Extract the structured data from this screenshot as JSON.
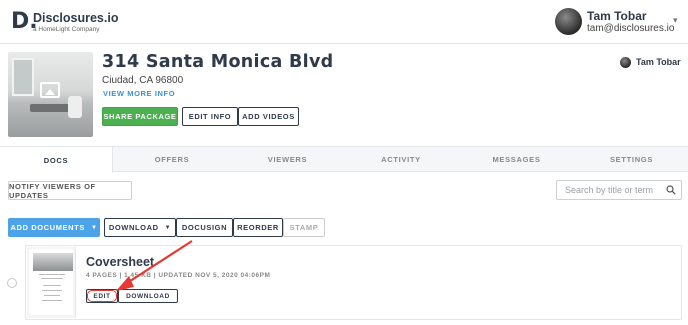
{
  "app": {
    "logo_mark": "D.",
    "name": "Disclosures.io",
    "tagline": "a HomeLight Company"
  },
  "user": {
    "name": "Tam Tobar",
    "email": "tam@disclosures.io"
  },
  "property": {
    "address": "314 Santa Monica Blvd",
    "city_line": "Ciudad, CA 96800",
    "view_more": "VIEW MORE INFO",
    "agent_name": "Tam Tobar",
    "actions": {
      "share": "SHARE PACKAGE",
      "edit_info": "EDIT INFO",
      "add_videos": "ADD VIDEOS"
    }
  },
  "tabs": [
    {
      "label": "DOCS",
      "active": true
    },
    {
      "label": "OFFERS"
    },
    {
      "label": "VIEWERS"
    },
    {
      "label": "ACTIVITY"
    },
    {
      "label": "MESSAGES"
    },
    {
      "label": "SETTINGS"
    }
  ],
  "toolbar": {
    "notify": "NOTIFY VIEWERS OF UPDATES",
    "search_placeholder": "Search by title or term",
    "add_documents": "ADD DOCUMENTS",
    "download": "DOWNLOAD",
    "docusign": "DOCUSIGN",
    "reorder": "REORDER",
    "stamp": "STAMP"
  },
  "document": {
    "title": "Coversheet",
    "meta": "4 PAGES | 1.45 KB | UPDATED NOV 5, 2020 04:06PM",
    "edit": "EDIT",
    "download": "DOWNLOAD",
    "thumb_heading": "314 Santa Monica Blvd"
  },
  "colors": {
    "primary_text": "#2f3a4a",
    "link_blue": "#3b8fd9",
    "share_green": "#4caf50",
    "add_docs_blue": "#4da3e8",
    "annotation_red": "#e53935"
  }
}
